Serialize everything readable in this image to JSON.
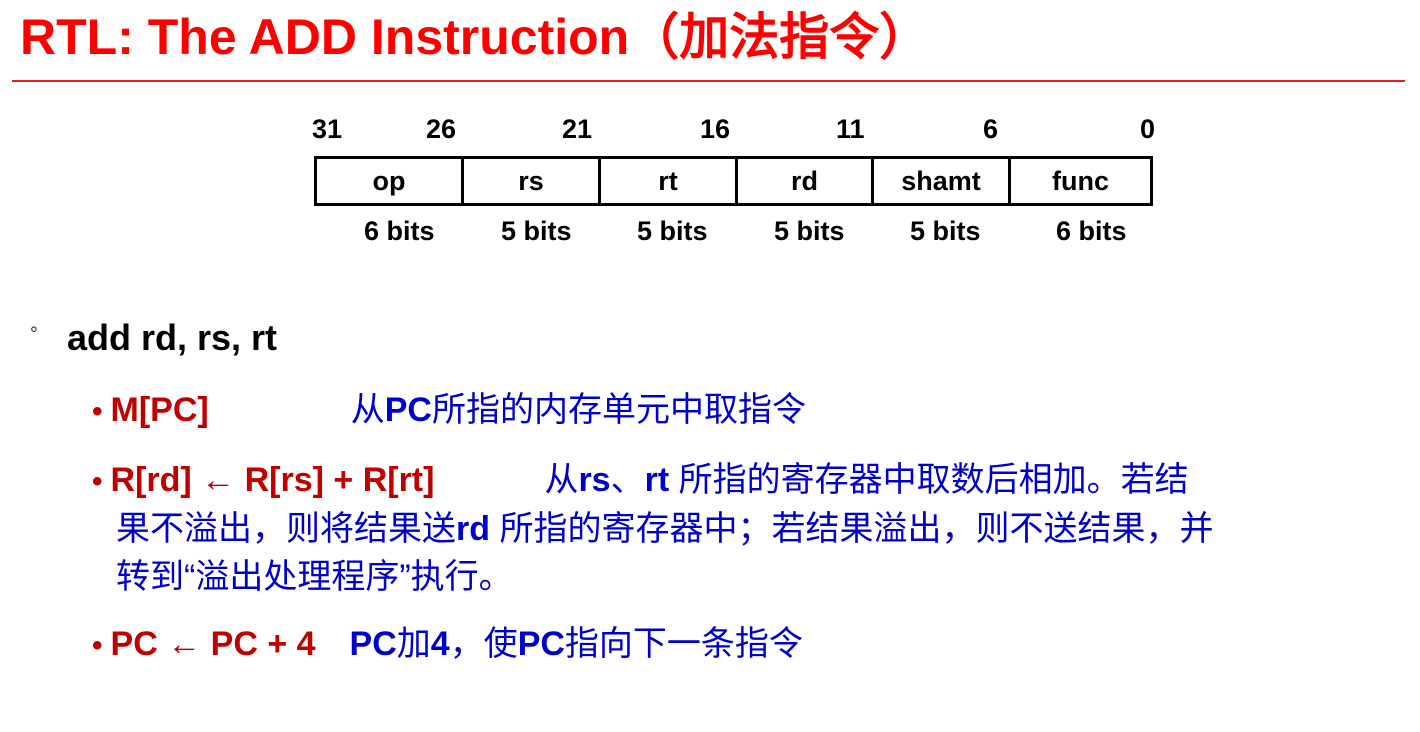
{
  "title": "RTL:  The ADD Instruction（加法指令）",
  "format": {
    "bit_numbers": [
      "31",
      "26",
      "21",
      "16",
      "11",
      "6",
      "0"
    ],
    "fields": [
      "op",
      "rs",
      "rt",
      "rd",
      "shamt",
      "func"
    ],
    "widths": [
      "6 bits",
      "5 bits",
      "5 bits",
      "5 bits",
      "5 bits",
      "6 bits"
    ]
  },
  "bullet_marker": "◦",
  "instruction": "add  rd, rs, rt",
  "steps": [
    {
      "marker": "•",
      "rtl": "M[PC]",
      "desc_prefix": "从",
      "desc_bold": "PC",
      "desc_rest": "所指的内存单元中取指令"
    },
    {
      "marker": "•",
      "rtl": "R[rd] ← R[rs] + R[rt]",
      "desc_prefix": "从",
      "desc_bold_1": "rs",
      "desc_sep": "、",
      "desc_bold_2": "rt",
      "desc_line1_rest": " 所指的寄存器中取数后相加。若结",
      "desc_line2_a": "果不溢出，则将结果送",
      "desc_line2_bold": "rd",
      "desc_line2_b": " 所指的寄存器中；若结果溢出，则不送结果，并",
      "desc_line3": "转到“溢出处理程序”执行。"
    },
    {
      "marker": "•",
      "rtl": "PC ← PC + 4",
      "desc_bold_1": "PC",
      "desc_mid": "加",
      "desc_bold_2": "4",
      "desc_sep": "，使",
      "desc_bold_3": "PC",
      "desc_rest": "指向下一条指令"
    }
  ],
  "colors": {
    "title": "#ff0000",
    "rtl": "#c00000",
    "description": "#0000cc"
  }
}
